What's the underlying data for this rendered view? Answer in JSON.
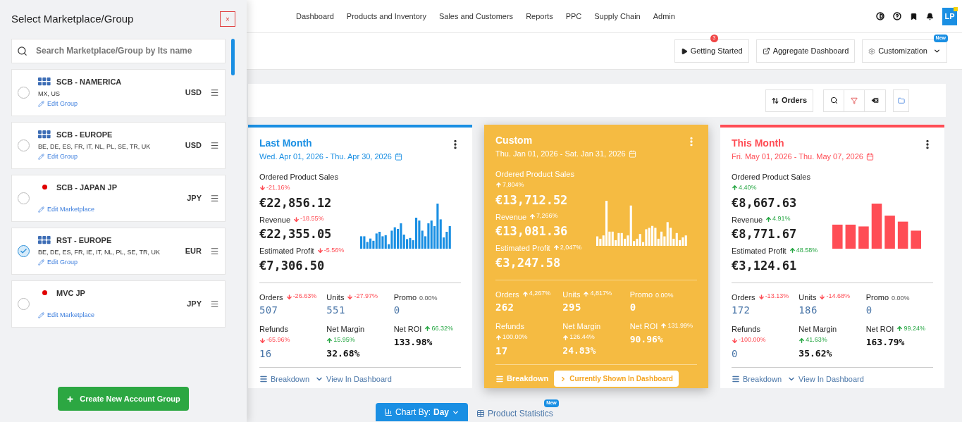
{
  "sidebar": {
    "title": "Select Marketplace/Group",
    "close_label": "×",
    "search": {
      "placeholder": "Search Marketplace/Group by Its name"
    },
    "items": [
      {
        "kind": "group",
        "name": "SCB - NAMERICA",
        "regions": "MX, US",
        "edit_label": "Edit Group",
        "currency": "USD",
        "selected": false
      },
      {
        "kind": "group",
        "name": "SCB - EUROPE",
        "regions": "BE, DE, ES, FR, IT, NL, PL, SE, TR, UK",
        "edit_label": "Edit Group",
        "currency": "USD",
        "selected": false
      },
      {
        "kind": "marketplace",
        "name": "SCB - JAPAN JP",
        "color": "#e00000",
        "edit_label": "Edit Marketplace",
        "currency": "JPY",
        "selected": false
      },
      {
        "kind": "group",
        "name": "RST - EUROPE",
        "regions": "BE, DE, ES, FR, IE, IT, NL, PL, SE, TR, UK",
        "edit_label": "Edit Group",
        "currency": "EUR",
        "selected": true
      },
      {
        "kind": "marketplace",
        "name": "MVC JP",
        "color": "#e00000",
        "edit_label": "Edit Marketplace",
        "currency": "JPY",
        "selected": false
      }
    ],
    "create_button": "Create New Account Group"
  },
  "nav": {
    "items": [
      "Dashboard",
      "Products and Inventory",
      "Sales and Customers",
      "Reports",
      "PPC",
      "Supply Chain",
      "Admin"
    ],
    "avatar": "LP"
  },
  "actions": [
    {
      "kind": "play",
      "label": "Getting Started",
      "badge": "3"
    },
    {
      "kind": "external",
      "label": "Aggregate Dashboard"
    },
    {
      "kind": "settings",
      "label": "Customization",
      "badge": "New"
    }
  ],
  "toolbar": {
    "sort_label": "Orders"
  },
  "cards": [
    {
      "kind": "outline",
      "color": "#1a8fe3",
      "title": "Last Month",
      "date_range": "Wed. Apr 01, 2026 - Thu. Apr 30, 2026",
      "headline": [
        {
          "label": "Ordered Product Sales",
          "change": "-21.16%",
          "kind": "down",
          "value": "€22,856.12"
        },
        {
          "label": "Revenue",
          "change": "-18.55%",
          "kind": "down",
          "value": "€22,355.05"
        },
        {
          "label": "Estimated Profit",
          "change": "-5.56%",
          "kind": "down",
          "value": "€7,306.50"
        }
      ],
      "stats": [
        {
          "emphasized": false,
          "label": "Orders",
          "change": "-26.63%",
          "kind": "down",
          "value": "507"
        },
        {
          "emphasized": false,
          "label": "Units",
          "change": "-27.97%",
          "kind": "down",
          "value": "551"
        },
        {
          "emphasized": false,
          "label": "Promo",
          "change": "0.00%",
          "kind": "flat",
          "value": "0"
        },
        {
          "emphasized": false,
          "label": "Refunds",
          "change": "-65.96%",
          "kind": "down",
          "value": "16"
        },
        {
          "emphasized": true,
          "label": "Net Margin",
          "change": "15.95%",
          "kind": "up",
          "value": "32.68%"
        },
        {
          "emphasized": true,
          "label": "Net ROI",
          "change": "66.32%",
          "kind": "up",
          "value": "133.98%"
        }
      ],
      "footer": [
        {
          "kind": "breakdown",
          "label": "Breakdown"
        },
        {
          "kind": "view",
          "label": "View In Dashboard"
        }
      ]
    },
    {
      "kind": "filled",
      "color": "#f5bb42",
      "title": "Custom",
      "date_range": "Thu. Jan 01, 2026 - Sat. Jan 31, 2026",
      "headline": [
        {
          "label": "Ordered Product Sales",
          "change": "7,804%",
          "kind": "up",
          "value": "€13,712.52"
        },
        {
          "label": "Revenue",
          "change": "7,266%",
          "kind": "up",
          "value": "€13,081.36"
        },
        {
          "label": "Estimated Profit",
          "change": "2,047%",
          "kind": "up",
          "value": "€3,247.58"
        }
      ],
      "stats": [
        {
          "emphasized": false,
          "label": "Orders",
          "change": "4,267%",
          "kind": "up",
          "value": "262"
        },
        {
          "emphasized": false,
          "label": "Units",
          "change": "4,817%",
          "kind": "up",
          "value": "295"
        },
        {
          "emphasized": false,
          "label": "Promo",
          "change": "0.00%",
          "kind": "flat",
          "value": "0"
        },
        {
          "emphasized": false,
          "label": "Refunds",
          "change": "100.00%",
          "kind": "up",
          "value": "17"
        },
        {
          "emphasized": true,
          "label": "Net Margin",
          "change": "126.44%",
          "kind": "up",
          "value": "24.83%"
        },
        {
          "emphasized": true,
          "label": "Net ROI",
          "change": "131.99%",
          "kind": "up",
          "value": "90.96%"
        }
      ],
      "footer": [
        {
          "kind": "breakdown",
          "label": "Breakdown"
        },
        {
          "kind": "current",
          "label": "Currently Shown In Dashboard"
        }
      ]
    },
    {
      "kind": "outline",
      "color": "#ff4d55",
      "title": "This Month",
      "date_range": "Fri. May 01, 2026 - Thu. May 07, 2026",
      "headline": [
        {
          "label": "Ordered Product Sales",
          "change": "4.40%",
          "kind": "up",
          "value": "€8,667.63"
        },
        {
          "label": "Revenue",
          "change": "4.91%",
          "kind": "up",
          "value": "€8,771.67"
        },
        {
          "label": "Estimated Profit",
          "change": "48.58%",
          "kind": "up",
          "value": "€3,124.61"
        }
      ],
      "stats": [
        {
          "emphasized": false,
          "label": "Orders",
          "change": "-13.13%",
          "kind": "down",
          "value": "172"
        },
        {
          "emphasized": false,
          "label": "Units",
          "change": "-14.68%",
          "kind": "down",
          "value": "186"
        },
        {
          "emphasized": false,
          "label": "Promo",
          "change": "0.00%",
          "kind": "flat",
          "value": "0"
        },
        {
          "emphasized": false,
          "label": "Refunds",
          "change": "-100.00%",
          "kind": "down",
          "value": "0"
        },
        {
          "emphasized": true,
          "label": "Net Margin",
          "change": "41.63%",
          "kind": "up",
          "value": "35.62%"
        },
        {
          "emphasized": true,
          "label": "Net ROI",
          "change": "99.24%",
          "kind": "up",
          "value": "163.79%"
        }
      ],
      "footer": [
        {
          "kind": "breakdown",
          "label": "Breakdown"
        },
        {
          "kind": "view",
          "label": "View In Dashboard"
        }
      ]
    }
  ],
  "bottom": {
    "chart_by_label": "Chart By:",
    "chart_by_value": "Day",
    "stats_label": "Product Statistics",
    "stats_badge": "New"
  }
}
